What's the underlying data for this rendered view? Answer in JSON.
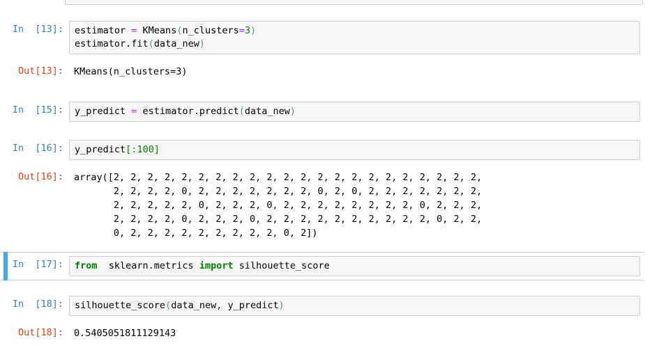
{
  "notebook": {
    "kernel_language": "python",
    "colors": {
      "in_prompt": "#307fc1",
      "out_prompt": "#d84315",
      "selection_bar": "#42a5f5",
      "input_bg": "#f7f7f7",
      "input_border": "#cfcfcf",
      "keyword": "#008000",
      "operator": "#aa22ff",
      "number": "#008000",
      "punctuation": "#4aa08a",
      "page_bg": "#ffffff"
    }
  },
  "cells": [
    {
      "id": "partial-top",
      "type": "code",
      "prompt": "",
      "selected": false,
      "clipped": true
    },
    {
      "id": "cell-13",
      "type": "code",
      "prompt_in": "In  [13]:",
      "selected": false,
      "source_line_1_a": "estimator ",
      "source_line_1_op": "=",
      "source_line_1_b": " KMeans",
      "source_line_1_paren_open": "(",
      "source_line_1_arg": "n_clusters",
      "source_line_1_eq": "=",
      "source_line_1_num": "3",
      "source_line_1_paren_close": ")",
      "source_line_2_a": "estimator.fit",
      "source_line_2_paren_open": "(",
      "source_line_2_arg": "data_new",
      "source_line_2_paren_close": ")",
      "prompt_out": "Out[13]:",
      "output_text": "KMeans(n_clusters=3)"
    },
    {
      "id": "cell-15",
      "type": "code",
      "prompt_in": "In  [15]:",
      "selected": false,
      "source_a": "y_predict ",
      "source_op": "=",
      "source_b": " estimator.predict",
      "source_paren_open": "(",
      "source_arg": "data_new",
      "source_paren_close": ")"
    },
    {
      "id": "cell-16",
      "type": "code",
      "prompt_in": "In  [16]:",
      "selected": false,
      "source_a": "y_predict",
      "source_brk_open": "[",
      "source_colon": ":",
      "source_num": "100",
      "source_brk_close": "]",
      "prompt_out": "Out[16]:",
      "output_text": "array([2, 2, 2, 2, 2, 2, 2, 2, 2, 2, 2, 2, 2, 2, 2, 2, 2, 2, 2, 2, 2, 2,\n       2, 2, 2, 2, 0, 2, 2, 2, 2, 2, 2, 2, 0, 2, 0, 2, 2, 2, 2, 2, 2, 2,\n       2, 2, 2, 2, 2, 0, 2, 2, 2, 0, 2, 2, 2, 2, 2, 2, 2, 2, 0, 2, 2, 2,\n       2, 2, 2, 2, 0, 2, 2, 2, 0, 2, 2, 2, 2, 2, 2, 2, 2, 2, 2, 0, 2, 2,\n       0, 2, 2, 2, 2, 2, 2, 2, 2, 2, 0, 2])"
    },
    {
      "id": "cell-17",
      "type": "code",
      "prompt_in": "In  [17]:",
      "selected": true,
      "source_kw1": "from",
      "source_mid": "  sklearn.metrics ",
      "source_kw2": "import",
      "source_tail": " silhouette_score"
    },
    {
      "id": "cell-18",
      "type": "code",
      "prompt_in": "In  [18]:",
      "selected": false,
      "source_a": "silhouette_score",
      "source_paren_open": "(",
      "source_args": "data_new, y_predict",
      "source_paren_close": ")",
      "prompt_out": "Out[18]:",
      "output_text": "0.5405051811129143"
    }
  ]
}
